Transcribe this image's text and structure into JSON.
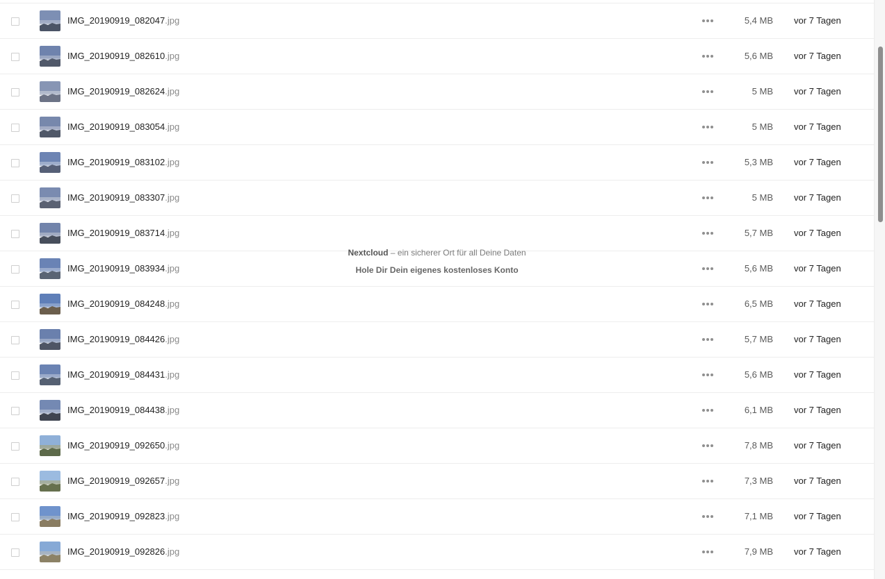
{
  "files": [
    {
      "base": "IMG_20190919_082047",
      "ext": ".jpg",
      "size": "5,4 MB",
      "modified": "vor 7 Tagen",
      "thumb": {
        "sky": "#7d8fb4",
        "mid": "#a7b2c8",
        "ground": "#4b5466"
      }
    },
    {
      "base": "IMG_20190919_082610",
      "ext": ".jpg",
      "size": "5,6 MB",
      "modified": "vor 7 Tagen",
      "thumb": {
        "sky": "#6f83ad",
        "mid": "#a3aec6",
        "ground": "#51596a"
      }
    },
    {
      "base": "IMG_20190919_082624",
      "ext": ".jpg",
      "size": "5 MB",
      "modified": "vor 7 Tagen",
      "thumb": {
        "sky": "#8795b4",
        "mid": "#b9bfcf",
        "ground": "#6c7386"
      }
    },
    {
      "base": "IMG_20190919_083054",
      "ext": ".jpg",
      "size": "5 MB",
      "modified": "vor 7 Tagen",
      "thumb": {
        "sky": "#7788ac",
        "mid": "#aab3c9",
        "ground": "#505868"
      }
    },
    {
      "base": "IMG_20190919_083102",
      "ext": ".jpg",
      "size": "5,3 MB",
      "modified": "vor 7 Tagen",
      "thumb": {
        "sky": "#6d84b3",
        "mid": "#a6b4cf",
        "ground": "#566077"
      }
    },
    {
      "base": "IMG_20190919_083307",
      "ext": ".jpg",
      "size": "5 MB",
      "modified": "vor 7 Tagen",
      "thumb": {
        "sky": "#7a8bb0",
        "mid": "#b0b8cc",
        "ground": "#5a6172"
      }
    },
    {
      "base": "IMG_20190919_083714",
      "ext": ".jpg",
      "size": "5,7 MB",
      "modified": "vor 7 Tagen",
      "thumb": {
        "sky": "#7284ab",
        "mid": "#a9b2c6",
        "ground": "#474e5c"
      }
    },
    {
      "base": "IMG_20190919_083934",
      "ext": ".jpg",
      "size": "5,6 MB",
      "modified": "vor 7 Tagen",
      "thumb": {
        "sky": "#6a83b5",
        "mid": "#a1b2d0",
        "ground": "#5a6474"
      }
    },
    {
      "base": "IMG_20190919_084248",
      "ext": ".jpg",
      "size": "6,5 MB",
      "modified": "vor 7 Tagen",
      "thumb": {
        "sky": "#5f7fb8",
        "mid": "#8fa6cc",
        "ground": "#6b5e4c"
      }
    },
    {
      "base": "IMG_20190919_084426",
      "ext": ".jpg",
      "size": "5,7 MB",
      "modified": "vor 7 Tagen",
      "thumb": {
        "sky": "#6a80ad",
        "mid": "#9fadc8",
        "ground": "#4e5565"
      }
    },
    {
      "base": "IMG_20190919_084431",
      "ext": ".jpg",
      "size": "5,6 MB",
      "modified": "vor 7 Tagen",
      "thumb": {
        "sky": "#6b83b3",
        "mid": "#a2b1cd",
        "ground": "#556072"
      }
    },
    {
      "base": "IMG_20190919_084438",
      "ext": ".jpg",
      "size": "6,1 MB",
      "modified": "vor 7 Tagen",
      "thumb": {
        "sky": "#7489b3",
        "mid": "#a9b5cd",
        "ground": "#3f4450"
      }
    },
    {
      "base": "IMG_20190919_092650",
      "ext": ".jpg",
      "size": "7,8 MB",
      "modified": "vor 7 Tagen",
      "thumb": {
        "sky": "#8fb0d8",
        "mid": "#9fa690",
        "ground": "#5d6a4a"
      }
    },
    {
      "base": "IMG_20190919_092657",
      "ext": ".jpg",
      "size": "7,3 MB",
      "modified": "vor 7 Tagen",
      "thumb": {
        "sky": "#9bbbe0",
        "mid": "#a5ab95",
        "ground": "#66704e"
      }
    },
    {
      "base": "IMG_20190919_092823",
      "ext": ".jpg",
      "size": "7,1 MB",
      "modified": "vor 7 Tagen",
      "thumb": {
        "sky": "#6f93cc",
        "mid": "#9eafc6",
        "ground": "#8a7d62"
      }
    },
    {
      "base": "IMG_20190919_092826",
      "ext": ".jpg",
      "size": "7,9 MB",
      "modified": "vor 7 Tagen",
      "thumb": {
        "sky": "#86a9d6",
        "mid": "#aab5bf",
        "ground": "#8c8266"
      }
    }
  ],
  "footer": {
    "brand": "Nextcloud",
    "tagline": " – ein sicherer Ort für all Deine Daten",
    "cta": "Hole Dir Dein eigenes kostenloses Konto"
  },
  "colors": {
    "row_divider": "#ededed",
    "text_primary": "#222222",
    "text_extension": "#8a8a8a",
    "scrollbar_thumb": "#8e8e8e"
  },
  "icons": {
    "row_actions": "more-horizontal-icon",
    "select": "checkbox"
  }
}
